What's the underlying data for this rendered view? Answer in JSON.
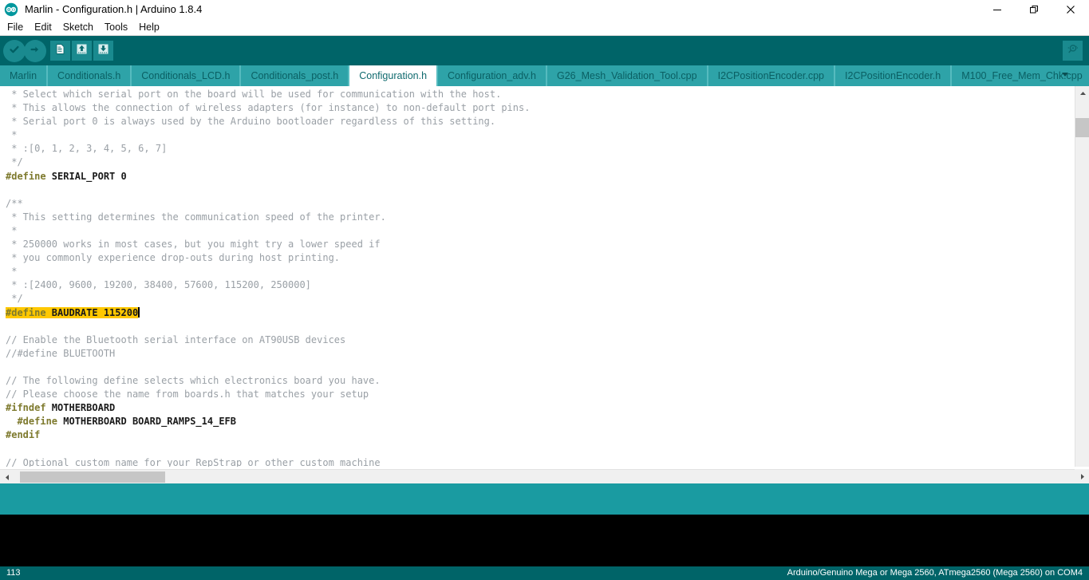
{
  "window": {
    "title": "Marlin - Configuration.h | Arduino 1.8.4",
    "logo_icon": "arduino-logo-icon",
    "controls": {
      "minimize": "—",
      "maximize": "❐",
      "close": "✕"
    }
  },
  "menubar": {
    "items": [
      {
        "label": "File"
      },
      {
        "label": "Edit"
      },
      {
        "label": "Sketch"
      },
      {
        "label": "Tools"
      },
      {
        "label": "Help"
      }
    ]
  },
  "toolbar": {
    "buttons": [
      {
        "name": "verify-button",
        "icon": "checkmark-icon",
        "tooltip": "Verify"
      },
      {
        "name": "upload-button",
        "icon": "arrow-right-icon",
        "tooltip": "Upload"
      },
      {
        "name": "new-button",
        "icon": "new-file-icon",
        "tooltip": "New"
      },
      {
        "name": "open-button",
        "icon": "arrow-up-icon",
        "tooltip": "Open"
      },
      {
        "name": "save-button",
        "icon": "arrow-down-icon",
        "tooltip": "Save"
      }
    ],
    "serial_monitor": {
      "name": "serial-monitor-button",
      "icon": "magnifier-icon"
    }
  },
  "tabs": {
    "active": "Configuration.h",
    "dropdown_icon": "chevron-down-icon",
    "items": [
      {
        "label": "Marlin",
        "active": false
      },
      {
        "label": "Conditionals.h",
        "active": false
      },
      {
        "label": "Conditionals_LCD.h",
        "active": false
      },
      {
        "label": "Conditionals_post.h",
        "active": false
      },
      {
        "label": "Configuration.h",
        "active": true
      },
      {
        "label": "Configuration_adv.h",
        "active": false
      },
      {
        "label": "G26_Mesh_Validation_Tool.cpp",
        "active": false
      },
      {
        "label": "I2CPositionEncoder.cpp",
        "active": false
      },
      {
        "label": "I2CPositionEncoder.h",
        "active": false
      },
      {
        "label": "M100_Free_Mem_Chk.cpp",
        "active": false
      }
    ]
  },
  "editor": {
    "lines": [
      {
        "segments": [
          {
            "t": " * Select which serial port on the board will be used for communication with the host.",
            "c": "cmt"
          }
        ]
      },
      {
        "segments": [
          {
            "t": " * This allows the connection of wireless adapters (for instance) to non-default port pins.",
            "c": "cmt"
          }
        ]
      },
      {
        "segments": [
          {
            "t": " * Serial port 0 is always used by the Arduino bootloader regardless of this setting.",
            "c": "cmt"
          }
        ]
      },
      {
        "segments": [
          {
            "t": " *",
            "c": "cmt"
          }
        ]
      },
      {
        "segments": [
          {
            "t": " * :[0, 1, 2, 3, 4, 5, 6, 7]",
            "c": "cmt"
          }
        ]
      },
      {
        "segments": [
          {
            "t": " */",
            "c": "cmt"
          }
        ]
      },
      {
        "segments": [
          {
            "t": "#define ",
            "c": "pre"
          },
          {
            "t": "SERIAL_PORT 0",
            "c": "idn"
          }
        ]
      },
      {
        "segments": [
          {
            "t": "",
            "c": "cmt"
          }
        ]
      },
      {
        "segments": [
          {
            "t": "/**",
            "c": "cmt"
          }
        ]
      },
      {
        "segments": [
          {
            "t": " * This setting determines the communication speed of the printer.",
            "c": "cmt"
          }
        ]
      },
      {
        "segments": [
          {
            "t": " *",
            "c": "cmt"
          }
        ]
      },
      {
        "segments": [
          {
            "t": " * 250000 works in most cases, but you might try a lower speed if",
            "c": "cmt"
          }
        ]
      },
      {
        "segments": [
          {
            "t": " * you commonly experience drop-outs during host printing.",
            "c": "cmt"
          }
        ]
      },
      {
        "segments": [
          {
            "t": " *",
            "c": "cmt"
          }
        ]
      },
      {
        "segments": [
          {
            "t": " * :[2400, 9600, 19200, 38400, 57600, 115200, 250000]",
            "c": "cmt"
          }
        ]
      },
      {
        "segments": [
          {
            "t": " */",
            "c": "cmt"
          }
        ]
      },
      {
        "highlight": true,
        "caret": true,
        "segments": [
          {
            "t": "#define ",
            "c": "pre"
          },
          {
            "t": "BAUDRATE 115200",
            "c": "idn"
          }
        ]
      },
      {
        "segments": [
          {
            "t": "",
            "c": "cmt"
          }
        ]
      },
      {
        "segments": [
          {
            "t": "// Enable the Bluetooth serial interface on AT90USB devices",
            "c": "cmt"
          }
        ]
      },
      {
        "segments": [
          {
            "t": "//#define BLUETOOTH",
            "c": "cmt"
          }
        ]
      },
      {
        "segments": [
          {
            "t": "",
            "c": "cmt"
          }
        ]
      },
      {
        "segments": [
          {
            "t": "// The following define selects which electronics board you have.",
            "c": "cmt"
          }
        ]
      },
      {
        "segments": [
          {
            "t": "// Please choose the name from boards.h that matches your setup",
            "c": "cmt"
          }
        ]
      },
      {
        "segments": [
          {
            "t": "#ifndef ",
            "c": "pre"
          },
          {
            "t": "MOTHERBOARD",
            "c": "idn"
          }
        ]
      },
      {
        "segments": [
          {
            "t": "  #define ",
            "c": "pre"
          },
          {
            "t": "MOTHERBOARD BOARD_RAMPS_14_EFB",
            "c": "idn"
          }
        ]
      },
      {
        "segments": [
          {
            "t": "#endif",
            "c": "pre"
          }
        ]
      },
      {
        "segments": [
          {
            "t": "",
            "c": "cmt"
          }
        ]
      },
      {
        "segments": [
          {
            "t": "// Optional custom name for your RepStrap or other custom machine",
            "c": "cmt"
          }
        ]
      }
    ],
    "scrollbars": {
      "vertical_up_icon": "chevron-up-icon",
      "horizontal_left_icon": "chevron-left-icon",
      "horizontal_right_icon": "chevron-right-icon"
    }
  },
  "footer": {
    "line_number": "113",
    "board_info": "Arduino/Genuino Mega or Mega 2560, ATmega2560 (Mega 2560) on COM4"
  },
  "colors": {
    "toolbar_bg": "#006468",
    "tab_bg": "#2ea3a8",
    "status_strip": "#1a9ba1",
    "console_bg": "#000000",
    "highlight": "#ffc800"
  }
}
